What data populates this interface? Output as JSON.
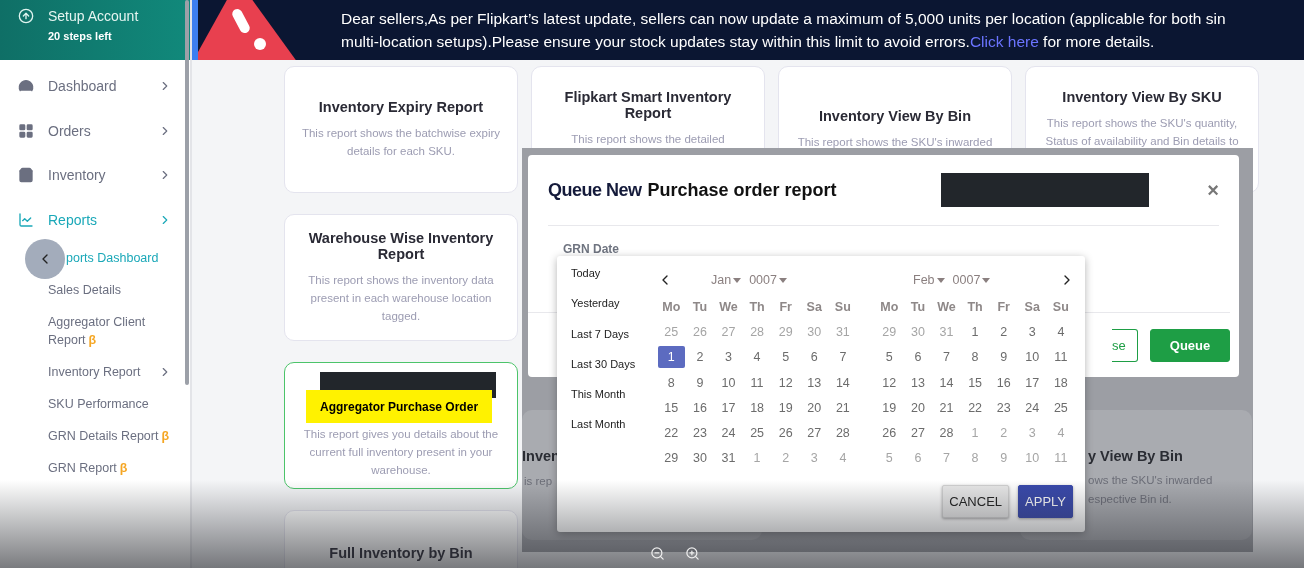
{
  "sidebar": {
    "setup": {
      "title": "Setup Account",
      "subtitle": "20 steps left"
    },
    "items": [
      {
        "label": "Dashboard",
        "selected": false
      },
      {
        "label": "Orders",
        "selected": false
      },
      {
        "label": "Inventory",
        "selected": false
      },
      {
        "label": "Reports",
        "selected": true
      }
    ],
    "subitems": [
      {
        "label": "ports Dashboard",
        "selected": true
      },
      {
        "label": "Sales Details",
        "selected": false
      },
      {
        "label": "Aggregator Client Report",
        "badge": "β",
        "selected": false
      },
      {
        "label": "Inventory Report",
        "expandable": true,
        "selected": false
      },
      {
        "label": "SKU Performance",
        "selected": false
      },
      {
        "label": "GRN Details Report",
        "badge": "β",
        "selected": false
      },
      {
        "label": "GRN Report",
        "badge": "β",
        "selected": false
      }
    ]
  },
  "banner": {
    "text": "Dear sellers,As per Flipkart’s latest update, sellers can now update a maximum of 5,000 units per location (applicable for both sin",
    "text2": "multi-location setups).Please ensure your stock updates stay within this limit to avoid errors.",
    "link": "Click here",
    "after": " for more details."
  },
  "cards": [
    {
      "kind": "report",
      "title": "Inventory Expiry Report",
      "description": "This report shows the batchwise expiry details for each SKU.",
      "selected": false
    },
    {
      "kind": "report",
      "title": "Flipkart Smart Inventory Report",
      "description": "This report shows the detailed",
      "selected": false
    },
    {
      "kind": "report",
      "title": "Inventory View By Bin",
      "description": "This report shows the SKU's inwarded",
      "selected": false
    },
    {
      "kind": "report",
      "title": "Inventory View By SKU",
      "description": "This report shows the SKU's quantity, Status of availability and Bin details to",
      "selected": false
    },
    {
      "kind": "report",
      "title": "Warehouse Wise Inventory Report",
      "description": "This report shows the inventory data present in each warehouse location tagged.",
      "selected": false
    },
    {
      "kind": "highlighted",
      "title": "Aggregator Purchase Order",
      "description": "This report gives you details about the current full inventory present in your warehouse.",
      "selected": true
    },
    {
      "kind": "report",
      "title": "Full Inventory by Bin",
      "selected": false
    }
  ],
  "background_fragments": [
    {
      "text": "Inven",
      "kind": "title"
    },
    {
      "text": "is rep",
      "kind": "body"
    },
    {
      "text": "y View By Bin",
      "kind": "title"
    },
    {
      "text": "ows the SKU's inwarded",
      "kind": "body"
    },
    {
      "text": "espective Bin id.",
      "kind": "body"
    }
  ],
  "modal": {
    "title_prefix": "Queue New",
    "title": "Purchase order report",
    "close": "×",
    "field_label": "GRN Date",
    "buttons": [
      {
        "label": "se",
        "kind": "outline"
      },
      {
        "label": "Queue",
        "kind": "primary"
      }
    ]
  },
  "datepicker": {
    "presets": [
      "Today",
      "Yesterday",
      "Last 7 Days",
      "Last 30 Days",
      "This Month",
      "Last Month"
    ],
    "calendars": [
      {
        "month": "Jan",
        "year": "0007",
        "weekdays": [
          "Mo",
          "Tu",
          "We",
          "Th",
          "Fr",
          "Sa",
          "Su"
        ],
        "weeks": [
          [
            {
              "d": "25",
              "outside": true,
              "selected": false
            },
            {
              "d": "26",
              "outside": true,
              "selected": false
            },
            {
              "d": "27",
              "outside": true,
              "selected": false
            },
            {
              "d": "28",
              "outside": true,
              "selected": false
            },
            {
              "d": "29",
              "outside": true,
              "selected": false
            },
            {
              "d": "30",
              "outside": true,
              "selected": false
            },
            {
              "d": "31",
              "outside": true,
              "selected": false
            }
          ],
          [
            {
              "d": "1",
              "outside": false,
              "selected": true
            },
            {
              "d": "2",
              "outside": false,
              "selected": false
            },
            {
              "d": "3",
              "outside": false,
              "selected": false
            },
            {
              "d": "4",
              "outside": false,
              "selected": false
            },
            {
              "d": "5",
              "outside": false,
              "selected": false
            },
            {
              "d": "6",
              "outside": false,
              "selected": false
            },
            {
              "d": "7",
              "outside": false,
              "selected": false
            }
          ],
          [
            {
              "d": "8",
              "outside": false,
              "selected": false
            },
            {
              "d": "9",
              "outside": false,
              "selected": false
            },
            {
              "d": "10",
              "outside": false,
              "selected": false
            },
            {
              "d": "11",
              "outside": false,
              "selected": false
            },
            {
              "d": "12",
              "outside": false,
              "selected": false
            },
            {
              "d": "13",
              "outside": false,
              "selected": false
            },
            {
              "d": "14",
              "outside": false,
              "selected": false
            }
          ],
          [
            {
              "d": "15",
              "outside": false,
              "selected": false
            },
            {
              "d": "16",
              "outside": false,
              "selected": false
            },
            {
              "d": "17",
              "outside": false,
              "selected": false
            },
            {
              "d": "18",
              "outside": false,
              "selected": false
            },
            {
              "d": "19",
              "outside": false,
              "selected": false
            },
            {
              "d": "20",
              "outside": false,
              "selected": false
            },
            {
              "d": "21",
              "outside": false,
              "selected": false
            }
          ],
          [
            {
              "d": "22",
              "outside": false,
              "selected": false
            },
            {
              "d": "23",
              "outside": false,
              "selected": false
            },
            {
              "d": "24",
              "outside": false,
              "selected": false
            },
            {
              "d": "25",
              "outside": false,
              "selected": false
            },
            {
              "d": "26",
              "outside": false,
              "selected": false
            },
            {
              "d": "27",
              "outside": false,
              "selected": false
            },
            {
              "d": "28",
              "outside": false,
              "selected": false
            }
          ],
          [
            {
              "d": "29",
              "outside": false,
              "selected": false
            },
            {
              "d": "30",
              "outside": false,
              "selected": false
            },
            {
              "d": "31",
              "outside": false,
              "selected": false
            },
            {
              "d": "1",
              "outside": true,
              "selected": false
            },
            {
              "d": "2",
              "outside": true,
              "selected": false
            },
            {
              "d": "3",
              "outside": true,
              "selected": false
            },
            {
              "d": "4",
              "outside": true,
              "selected": false
            }
          ]
        ]
      },
      {
        "month": "Feb",
        "year": "0007",
        "weekdays": [
          "Mo",
          "Tu",
          "We",
          "Th",
          "Fr",
          "Sa",
          "Su"
        ],
        "weeks": [
          [
            {
              "d": "29",
              "outside": true,
              "selected": false
            },
            {
              "d": "30",
              "outside": true,
              "selected": false
            },
            {
              "d": "31",
              "outside": true,
              "selected": false
            },
            {
              "d": "1",
              "outside": false,
              "selected": false
            },
            {
              "d": "2",
              "outside": false,
              "selected": false
            },
            {
              "d": "3",
              "outside": false,
              "selected": false
            },
            {
              "d": "4",
              "outside": false,
              "selected": false
            }
          ],
          [
            {
              "d": "5",
              "outside": false,
              "selected": false
            },
            {
              "d": "6",
              "outside": false,
              "selected": false
            },
            {
              "d": "7",
              "outside": false,
              "selected": false
            },
            {
              "d": "8",
              "outside": false,
              "selected": false
            },
            {
              "d": "9",
              "outside": false,
              "selected": false
            },
            {
              "d": "10",
              "outside": false,
              "selected": false
            },
            {
              "d": "11",
              "outside": false,
              "selected": false
            }
          ],
          [
            {
              "d": "12",
              "outside": false,
              "selected": false
            },
            {
              "d": "13",
              "outside": false,
              "selected": false
            },
            {
              "d": "14",
              "outside": false,
              "selected": false
            },
            {
              "d": "15",
              "outside": false,
              "selected": false
            },
            {
              "d": "16",
              "outside": false,
              "selected": false
            },
            {
              "d": "17",
              "outside": false,
              "selected": false
            },
            {
              "d": "18",
              "outside": false,
              "selected": false
            }
          ],
          [
            {
              "d": "19",
              "outside": false,
              "selected": false
            },
            {
              "d": "20",
              "outside": false,
              "selected": false
            },
            {
              "d": "21",
              "outside": false,
              "selected": false
            },
            {
              "d": "22",
              "outside": false,
              "selected": false
            },
            {
              "d": "23",
              "outside": false,
              "selected": false
            },
            {
              "d": "24",
              "outside": false,
              "selected": false
            },
            {
              "d": "25",
              "outside": false,
              "selected": false
            }
          ],
          [
            {
              "d": "26",
              "outside": false,
              "selected": false
            },
            {
              "d": "27",
              "outside": false,
              "selected": false
            },
            {
              "d": "28",
              "outside": false,
              "selected": false
            },
            {
              "d": "1",
              "outside": true,
              "selected": false
            },
            {
              "d": "2",
              "outside": true,
              "selected": false
            },
            {
              "d": "3",
              "outside": true,
              "selected": false
            },
            {
              "d": "4",
              "outside": true,
              "selected": false
            }
          ],
          [
            {
              "d": "5",
              "outside": true,
              "selected": false
            },
            {
              "d": "6",
              "outside": true,
              "selected": false
            },
            {
              "d": "7",
              "outside": true,
              "selected": false
            },
            {
              "d": "8",
              "outside": true,
              "selected": false
            },
            {
              "d": "9",
              "outside": true,
              "selected": false
            },
            {
              "d": "10",
              "outside": true,
              "selected": false
            },
            {
              "d": "11",
              "outside": true,
              "selected": false
            }
          ]
        ]
      }
    ],
    "buttons": [
      {
        "label": "CANCEL",
        "kind": "secondary"
      },
      {
        "label": "APPLY",
        "kind": "primary"
      }
    ]
  }
}
